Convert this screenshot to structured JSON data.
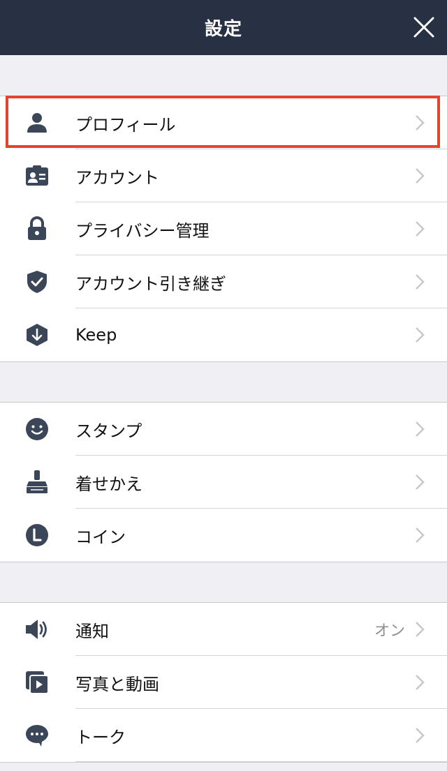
{
  "header": {
    "title": "設定",
    "close_icon": "close-icon"
  },
  "colors": {
    "header_bg": "#283044",
    "icon": "#3c4659",
    "highlight": "#e2442e"
  },
  "sections": [
    {
      "items": [
        {
          "label": "プロフィール",
          "icon": "person-icon",
          "highlighted": true
        },
        {
          "label": "アカウント",
          "icon": "id-card-icon"
        },
        {
          "label": "プライバシー管理",
          "icon": "lock-icon"
        },
        {
          "label": "アカウント引き継ぎ",
          "icon": "shield-check-icon"
        },
        {
          "label": "Keep",
          "icon": "keep-download-icon"
        }
      ]
    },
    {
      "items": [
        {
          "label": "スタンプ",
          "icon": "smiley-icon"
        },
        {
          "label": "着せかえ",
          "icon": "paintbrush-icon"
        },
        {
          "label": "コイン",
          "icon": "coin-icon"
        }
      ]
    },
    {
      "items": [
        {
          "label": "通知",
          "icon": "speaker-icon",
          "value": "オン"
        },
        {
          "label": "写真と動画",
          "icon": "photo-video-icon"
        },
        {
          "label": "トーク",
          "icon": "chat-bubble-icon"
        }
      ]
    }
  ]
}
